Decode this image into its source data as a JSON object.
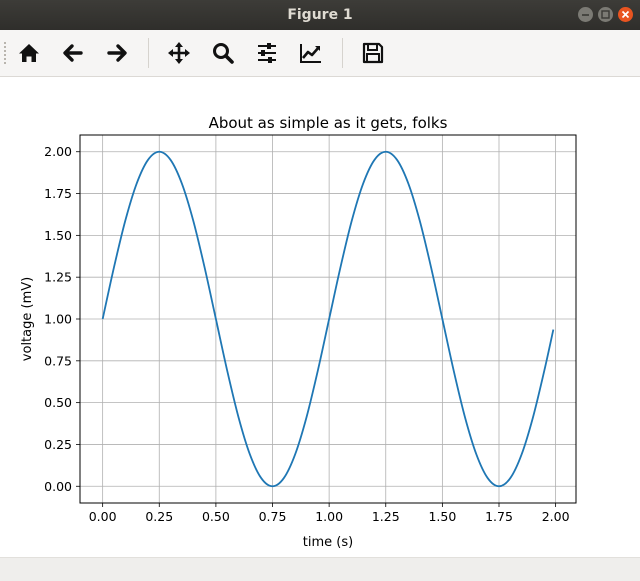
{
  "window": {
    "title": "Figure 1"
  },
  "toolbar": {
    "buttons": [
      {
        "name": "home",
        "icon": "home-icon"
      },
      {
        "name": "back",
        "icon": "arrow-left-icon"
      },
      {
        "name": "forward",
        "icon": "arrow-right-icon"
      },
      {
        "name": "pan",
        "icon": "move-icon"
      },
      {
        "name": "zoom",
        "icon": "magnifier-icon"
      },
      {
        "name": "subplots",
        "icon": "sliders-icon"
      },
      {
        "name": "edit-axes",
        "icon": "line-chart-icon"
      },
      {
        "name": "save",
        "icon": "floppy-disk-icon"
      }
    ]
  },
  "colors": {
    "line": "#1f77b4",
    "grid": "#b0b0b0",
    "close_button": "#e95420"
  },
  "chart_data": {
    "type": "line",
    "title": "About as simple as it gets, folks",
    "xlabel": "time (s)",
    "ylabel": "voltage (mV)",
    "xlim": [
      -0.1,
      2.09
    ],
    "ylim": [
      -0.1,
      2.1
    ],
    "xticks": [
      "0.00",
      "0.25",
      "0.50",
      "0.75",
      "1.00",
      "1.25",
      "1.50",
      "1.75",
      "2.00"
    ],
    "yticks": [
      "0.00",
      "0.25",
      "0.50",
      "0.75",
      "1.00",
      "1.25",
      "1.50",
      "1.75",
      "2.00"
    ],
    "grid": true,
    "series": [
      {
        "x": [
          0.0,
          0.05,
          0.1,
          0.15,
          0.2,
          0.25,
          0.3,
          0.35,
          0.4,
          0.45,
          0.5,
          0.55,
          0.6,
          0.65,
          0.7,
          0.75,
          0.8,
          0.85,
          0.9,
          0.95,
          1.0,
          1.05,
          1.1,
          1.15,
          1.2,
          1.25,
          1.3,
          1.35,
          1.4,
          1.45,
          1.5,
          1.55,
          1.6,
          1.65,
          1.7,
          1.75,
          1.8,
          1.85,
          1.9,
          1.95,
          1.99
        ],
        "y": [
          1.0,
          1.309,
          1.588,
          1.809,
          1.951,
          2.0,
          1.951,
          1.809,
          1.588,
          1.309,
          1.0,
          0.691,
          0.412,
          0.191,
          0.049,
          0.0,
          0.049,
          0.191,
          0.412,
          0.691,
          1.0,
          1.309,
          1.588,
          1.809,
          1.951,
          2.0,
          1.951,
          1.809,
          1.588,
          1.309,
          1.0,
          0.691,
          0.412,
          0.191,
          0.049,
          0.0,
          0.049,
          0.191,
          0.412,
          0.691,
          0.937
        ]
      }
    ]
  }
}
